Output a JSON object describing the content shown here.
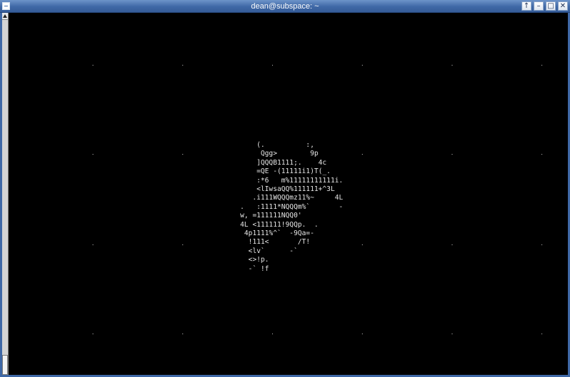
{
  "window": {
    "title": "dean@subspace: ~",
    "buttons": {
      "shade": "↑",
      "minimize": "–",
      "maximize": "□",
      "close": "✕"
    }
  },
  "terminal": {
    "background": "#000000",
    "foreground": "#e6e6e6",
    "ascii_art": "    (.          :,\n     Qgg>        9p\n    ]QQQB1111;.    4c\n    =QE -(11111i1)T(_.\n    :*6   m%11111111111i.\n    <lIwsaQQ%111111+^3L\n   .i111WQQQmz11%~     4L\n.   :1111*NQQQm%`       -\nw, =111111NQQ0'\n4L <111111!9QQp.  .\n 4p1111%^`  -9Qa=-\n  !111<       /T!\n  <lv`      -`\n  <>!p.\n  -` !f"
  },
  "scrollbar": {
    "up_arrow_icon": "up-arrow-icon"
  }
}
